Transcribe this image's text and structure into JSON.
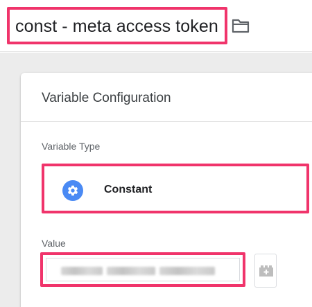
{
  "header": {
    "variable_name": "const - meta access token",
    "folder_icon": "folder-icon"
  },
  "card": {
    "title": "Variable Configuration",
    "variable_type_label": "Variable Type",
    "variable_type": {
      "name": "Constant",
      "icon": "gear-icon",
      "icon_color": "#4a8af4"
    },
    "value_label": "Value",
    "value_picker_icon": "variable-picker-icon"
  },
  "colors": {
    "highlight": "#f0346b",
    "canvas": "#ececec",
    "accent": "#4a8af4"
  }
}
